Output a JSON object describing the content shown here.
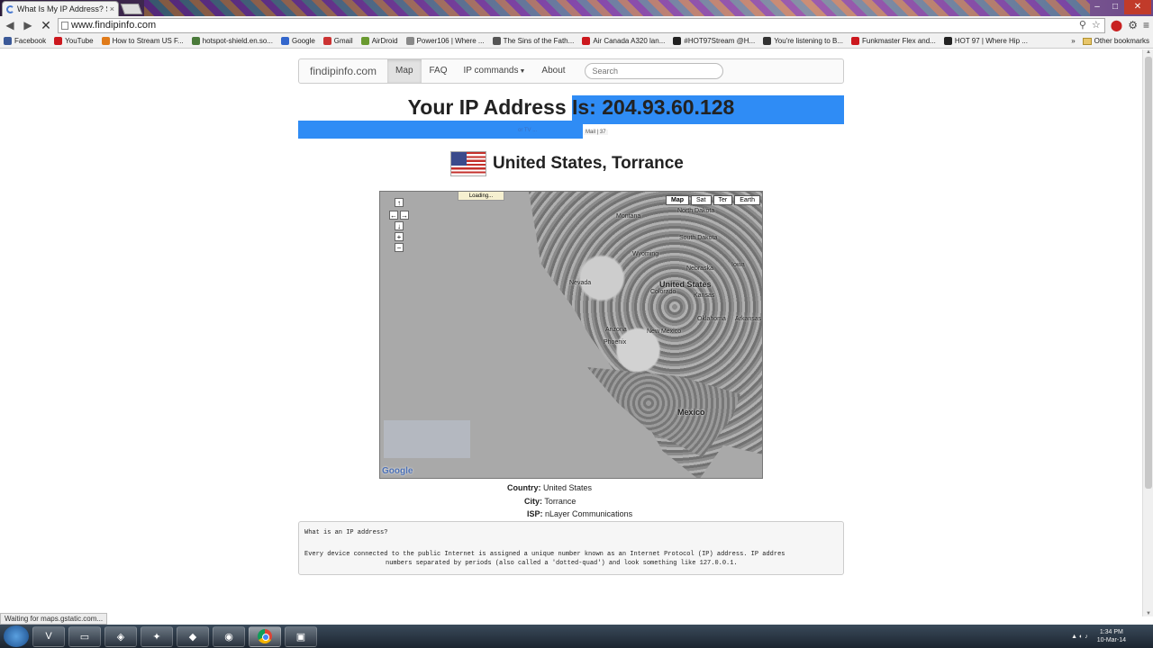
{
  "browser": {
    "tab_title": "What Is My IP Address? Sh",
    "tab_close": "×",
    "url": "www.findipinfo.com",
    "bookmarks": [
      {
        "label": "Facebook",
        "color": "#3b5998"
      },
      {
        "label": "YouTube",
        "color": "#cc181e"
      },
      {
        "label": "How to Stream US F...",
        "color": "#e07b1a"
      },
      {
        "label": "hotspot-shield.en.so...",
        "color": "#4a7a3a"
      },
      {
        "label": "Google",
        "color": "#3366cc"
      },
      {
        "label": "Gmail",
        "color": "#c33"
      },
      {
        "label": "AirDroid",
        "color": "#6a9a30"
      },
      {
        "label": "Power106 | Where ...",
        "color": "#888"
      },
      {
        "label": "The Sins of the Fath...",
        "color": "#555"
      },
      {
        "label": "Air Canada A320 lan...",
        "color": "#cc181e"
      },
      {
        "label": "#HOT97Stream @H...",
        "color": "#222"
      },
      {
        "label": "You're listening to B...",
        "color": "#333"
      },
      {
        "label": "Funkmaster Flex and...",
        "color": "#cc181e"
      },
      {
        "label": "HOT 97 | Where Hip ...",
        "color": "#222"
      }
    ],
    "bookmarks_more": "»",
    "other_bookmarks": "Other bookmarks",
    "status_text": "Waiting for maps.gstatic.com..."
  },
  "site": {
    "brand": "findipinfo.com",
    "nav": {
      "map": "Map",
      "faq": "FAQ",
      "ip_commands": "IP commands",
      "about": "About",
      "search_placeholder": "Search"
    },
    "ip_line": "Your IP Address Is: 204.93.60.128",
    "ip_selected": "204.93.60.128",
    "small_selected": "or TV ...",
    "mini_button": "Mail | 37",
    "location": "United States, Torrance",
    "map": {
      "loading": "Loading...",
      "types": [
        "Map",
        "Sat",
        "Ter",
        "Earth"
      ],
      "labels": [
        {
          "text": "Montana"
        },
        {
          "text": "North Dakota"
        },
        {
          "text": "South Dakota"
        },
        {
          "text": "Wyoming"
        },
        {
          "text": "Nebraska"
        },
        {
          "text": "Iowa"
        },
        {
          "text": "Nevada"
        },
        {
          "text": "United States"
        },
        {
          "text": "Colorado"
        },
        {
          "text": "Kansas"
        },
        {
          "text": "Oklahoma"
        },
        {
          "text": "Arkansas"
        },
        {
          "text": "New Mexico"
        },
        {
          "text": "Arizona"
        },
        {
          "text": "Phoenix"
        },
        {
          "text": "Mexico"
        },
        {
          "text": "Google"
        }
      ]
    },
    "info": {
      "country_label": "Country:",
      "country_value": "United States",
      "city_label": "City:",
      "city_value": "Torrance",
      "isp_label": "ISP:",
      "isp_value": "nLayer Communications"
    },
    "article": {
      "heading": "What is an IP address?",
      "line1": "Every device connected to the public Internet is assigned a unique number known as an Internet Protocol (IP) address. IP addres",
      "line2": "numbers separated by periods (also called a 'dotted-quad') and look something like 127.0.0.1."
    }
  },
  "taskbar": {
    "time": "1:34 PM",
    "date": "10-Mar-14"
  }
}
